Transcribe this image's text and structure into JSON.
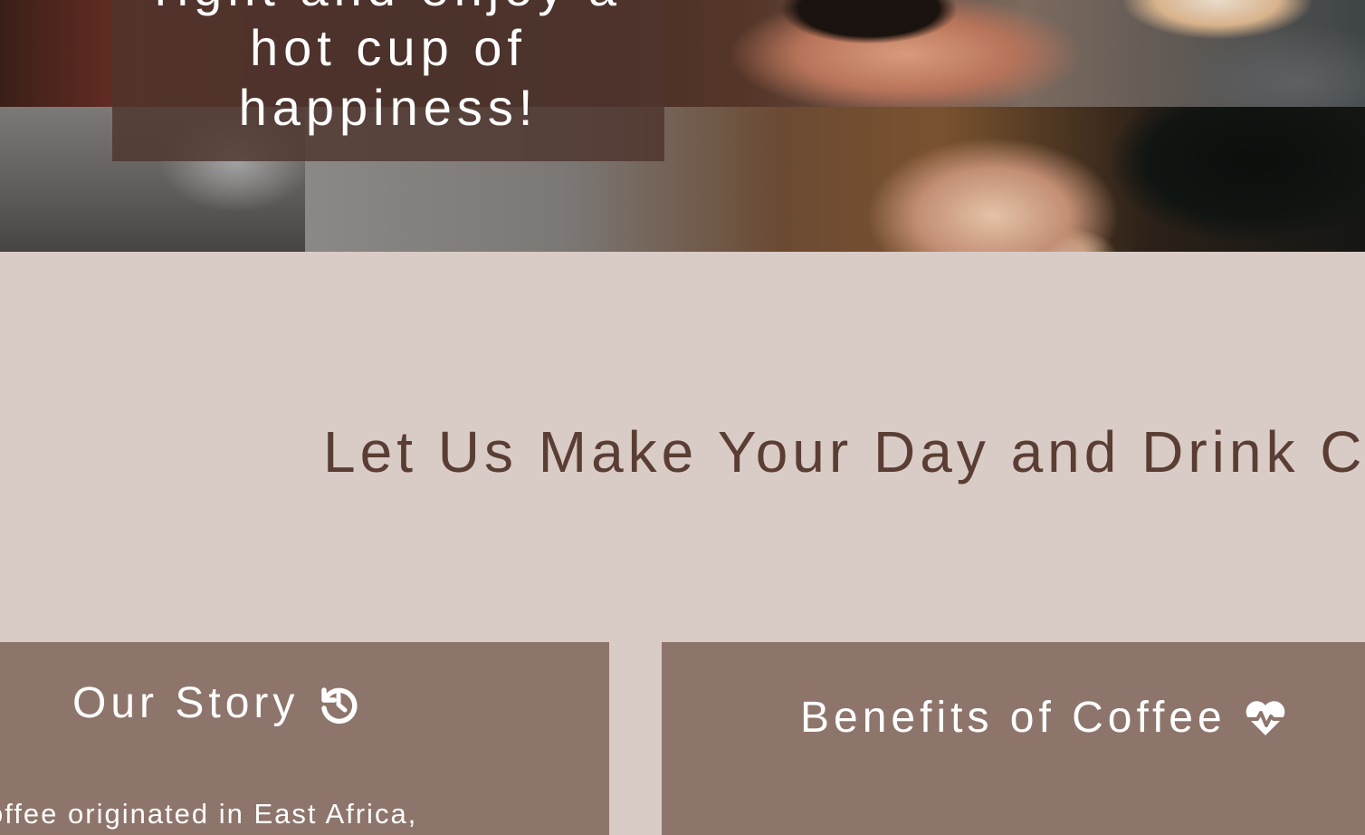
{
  "hero": {
    "caption_lines": [
      "right and enjoy a",
      "hot cup of",
      "happiness!"
    ]
  },
  "headline": "Let Us Make Your Day and Drink Co",
  "cards": {
    "story": {
      "title": "Our Story",
      "icon": "history-icon",
      "text": "offee originated in East Africa,"
    },
    "benefits": {
      "title": "Benefits of Coffee",
      "icon": "heartbeat-icon"
    }
  },
  "colors": {
    "background": "#d9cbc6",
    "card": "#8e756c",
    "caption_overlay": "#4e342d",
    "headline": "#5a3d33",
    "text_light": "#ffffff"
  }
}
